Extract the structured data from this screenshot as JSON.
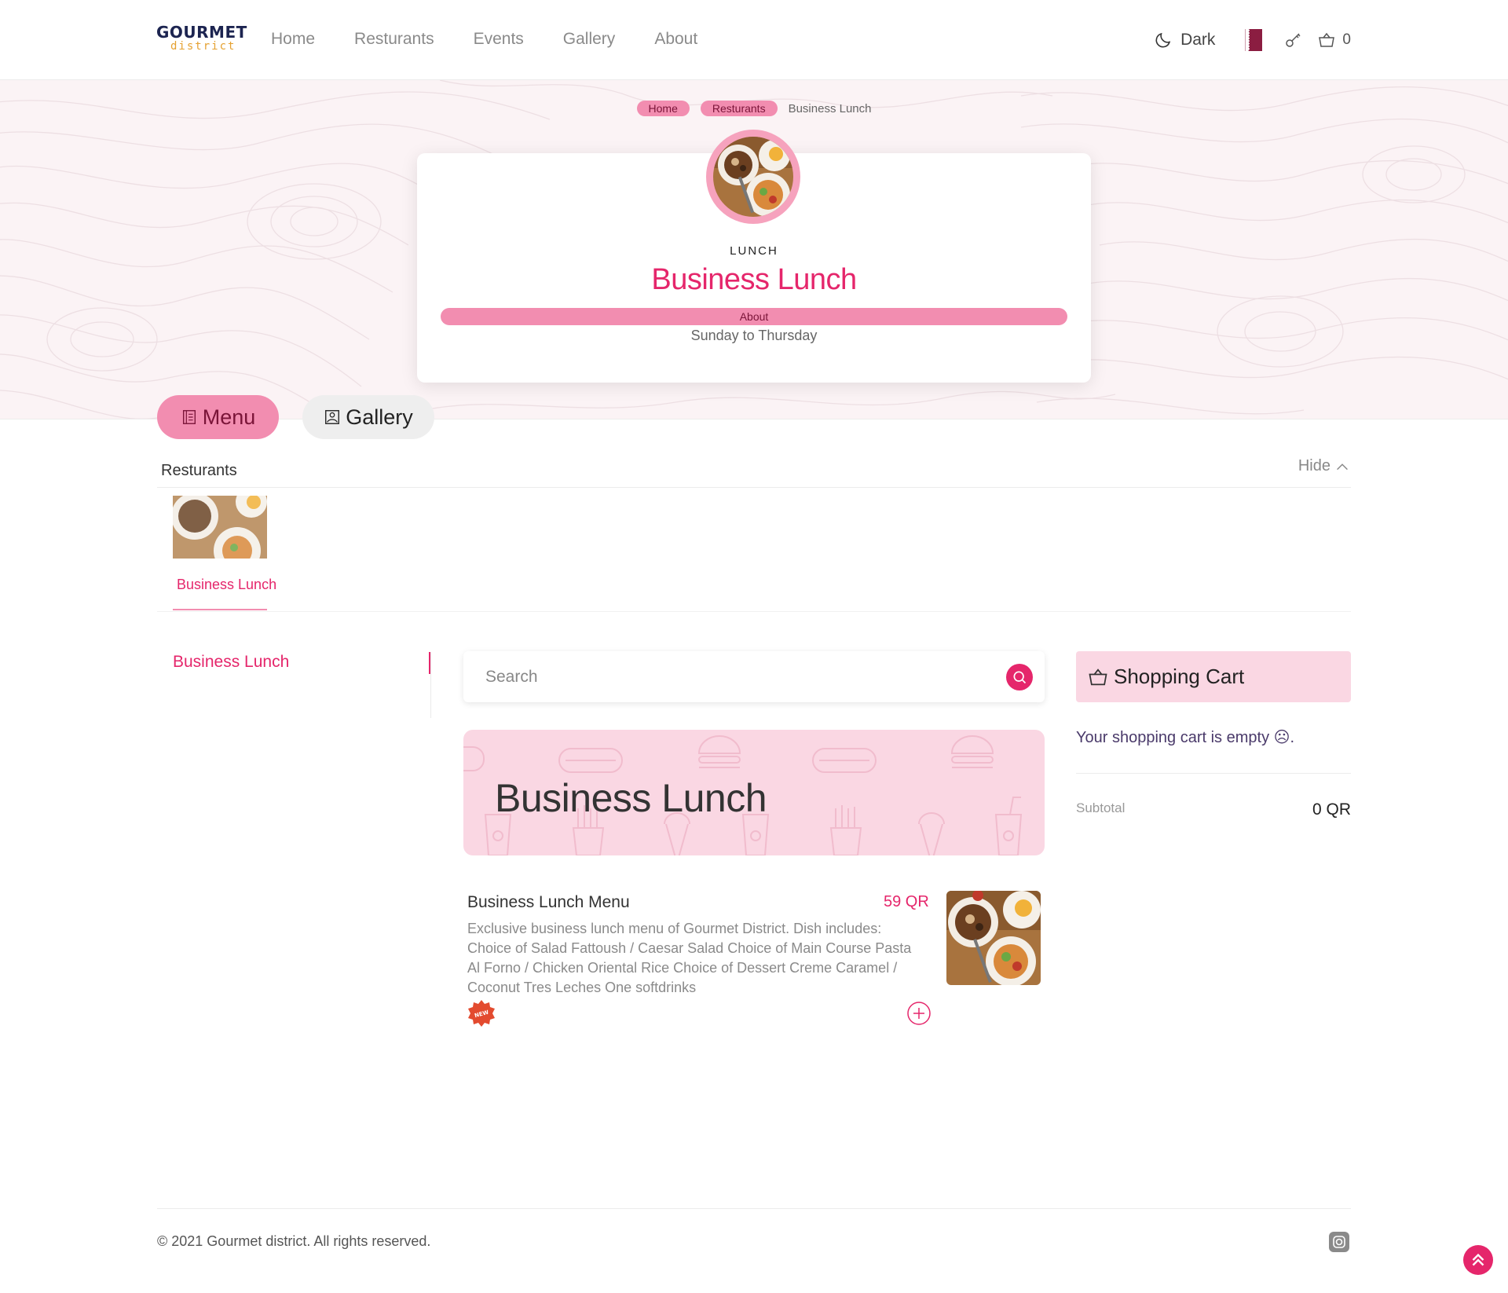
{
  "header": {
    "logo_top": "GOURMET",
    "logo_bottom": "district",
    "nav": [
      "Home",
      "Resturants",
      "Events",
      "Gallery",
      "About"
    ],
    "theme_toggle": "Dark",
    "cart_count": "0"
  },
  "breadcrumb": {
    "items": [
      "Home",
      "Resturants"
    ],
    "current": "Business Lunch"
  },
  "restaurant": {
    "category": "LUNCH",
    "name": "Business Lunch",
    "about_label": "About",
    "schedule": "Sunday to Thursday"
  },
  "tabs": {
    "menu": "Menu",
    "gallery": "Gallery"
  },
  "restaurants_strip": {
    "heading": "Resturants",
    "hide_label": "Hide",
    "items": [
      {
        "label": "Business Lunch"
      }
    ]
  },
  "sidebar": {
    "categories": [
      "Business Lunch"
    ]
  },
  "search": {
    "placeholder": "Search"
  },
  "banner": {
    "title": "Business Lunch"
  },
  "dishes": [
    {
      "name": "Business Lunch Menu",
      "price": "59 QR",
      "description": "Exclusive business lunch menu of Gourmet District. Dish includes: Choice of Salad Fattoush / Caesar Salad Choice of Main Course Pasta Al Forno / Chicken Oriental Rice Choice of Dessert Creme Caramel / Coconut Tres Leches One softdrinks",
      "badge": "NEW"
    }
  ],
  "cart": {
    "title": "Shopping Cart",
    "empty_message": "Your shopping cart is empty ☹.",
    "subtotal_label": "Subtotal",
    "subtotal_value": "0 QR"
  },
  "footer": {
    "copyright": "© 2021 Gourmet district. All rights reserved."
  },
  "colors": {
    "accent": "#e5266b",
    "pill": "#f28db0",
    "pale_pink": "#fad7e3",
    "navy": "#1c2450"
  }
}
